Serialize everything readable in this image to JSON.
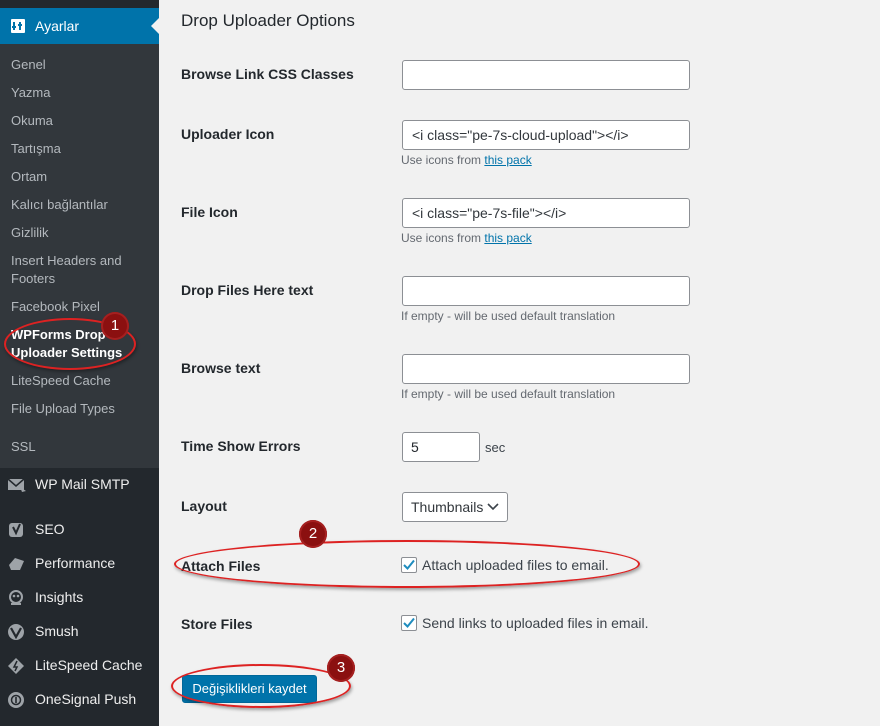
{
  "sidebar": {
    "settings_label": "Ayarlar",
    "submenu": [
      "Genel",
      "Yazma",
      "Okuma",
      "Tartışma",
      "Ortam",
      "Kalıcı bağlantılar",
      "Gizlilik",
      "Insert Headers and Footers",
      "Facebook Pixel",
      "WPForms Drop Uploader Settings",
      "LiteSpeed Cache",
      "File Upload Types",
      "SSL"
    ],
    "menu": [
      {
        "label": "WP Mail SMTP",
        "icon": "mail-icon"
      },
      {
        "label": "SEO",
        "icon": "yoast-icon"
      },
      {
        "label": "Performance",
        "icon": "performance-icon"
      },
      {
        "label": "Insights",
        "icon": "insights-icon"
      },
      {
        "label": "Smush",
        "icon": "smush-icon"
      },
      {
        "label": "LiteSpeed Cache",
        "icon": "litespeed-icon"
      },
      {
        "label": "OneSignal Push",
        "icon": "onesignal-icon"
      }
    ]
  },
  "main": {
    "title": "Drop Uploader Options",
    "fields": {
      "browse_css": {
        "label": "Browse Link CSS Classes",
        "value": ""
      },
      "uploader_icon": {
        "label": "Uploader Icon",
        "value": "<i class=\"pe-7s-cloud-upload\"></i>",
        "desc_prefix": "Use icons from ",
        "desc_link": "this pack"
      },
      "file_icon": {
        "label": "File Icon",
        "value": "<i class=\"pe-7s-file\"></i>",
        "desc_prefix": "Use icons from ",
        "desc_link": "this pack"
      },
      "drop_files_text": {
        "label": "Drop Files Here text",
        "value": "",
        "desc": "If empty - will be used default translation"
      },
      "browse_text": {
        "label": "Browse text",
        "value": "",
        "desc": "If empty - will be used default translation"
      },
      "time_show_errors": {
        "label": "Time Show Errors",
        "value": "5",
        "unit": "sec"
      },
      "layout": {
        "label": "Layout",
        "value": "Thumbnails"
      },
      "attach_files": {
        "label": "Attach Files",
        "checkbox_label": "Attach uploaded files to email.",
        "checked": true
      },
      "store_files": {
        "label": "Store Files",
        "checkbox_label": "Send links to uploaded files in email.",
        "checked": true
      }
    },
    "save_button": "Değişiklikleri kaydet"
  },
  "annotations": [
    "1",
    "2",
    "3"
  ],
  "colors": {
    "accent": "#0073aa",
    "sidebar": "#23282d",
    "annotation": "#d22222"
  }
}
